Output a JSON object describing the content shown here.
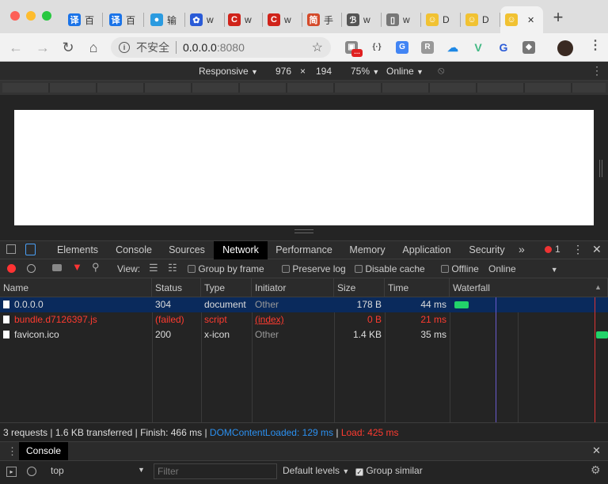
{
  "browser": {
    "tabs": [
      {
        "title": "百",
        "icon": "translate-icon",
        "color": "#1a73e8",
        "glyph": "译"
      },
      {
        "title": "百",
        "icon": "translate-icon",
        "color": "#1a73e8",
        "glyph": "译"
      },
      {
        "title": "输",
        "icon": "input-icon",
        "color": "#2b9be0",
        "glyph": "●"
      },
      {
        "title": "w",
        "icon": "baidu-paw-icon",
        "color": "#2a5bd7",
        "glyph": "✿"
      },
      {
        "title": "w",
        "icon": "c-logo-icon",
        "color": "#d0231a",
        "glyph": "C"
      },
      {
        "title": "w",
        "icon": "c-logo-icon",
        "color": "#d0231a",
        "glyph": "C"
      },
      {
        "title": "手",
        "icon": "jian-icon",
        "color": "#d44a2a",
        "glyph": "简"
      },
      {
        "title": "w",
        "icon": "script-icon",
        "color": "#555555",
        "glyph": "ℬ"
      },
      {
        "title": "w",
        "icon": "file-icon",
        "color": "#777777",
        "glyph": "▯"
      },
      {
        "title": "D",
        "icon": "smiley-icon",
        "color": "#f1c232",
        "glyph": "☺"
      },
      {
        "title": "D",
        "icon": "smiley-icon",
        "color": "#f1c232",
        "glyph": "☺"
      },
      {
        "title": "",
        "icon": "smiley-icon",
        "color": "#f1c232",
        "glyph": "☺"
      }
    ],
    "new_tab": "+",
    "address": {
      "security": "不安全",
      "host": "0.0.0.0",
      "port": ":8080"
    }
  },
  "device_toolbar": {
    "device": "Responsive",
    "width": "976",
    "times": "×",
    "height": "194",
    "zoom": "75%",
    "throttle": "Online"
  },
  "devtools": {
    "tabs": [
      "Elements",
      "Console",
      "Sources",
      "Network",
      "Performance",
      "Memory",
      "Application",
      "Security"
    ],
    "more": "»",
    "error_count": "1",
    "network_toolbar": {
      "view_label": "View:",
      "group_by_frame": "Group by frame",
      "preserve_log": "Preserve log",
      "disable_cache": "Disable cache",
      "offline": "Offline",
      "throttle": "Online"
    },
    "columns": [
      "Name",
      "Status",
      "Type",
      "Initiator",
      "Size",
      "Time",
      "Waterfall"
    ],
    "rows": [
      {
        "name": "0.0.0.0",
        "status": "304",
        "type": "document",
        "initiator": "Other",
        "size": "178 B",
        "time": "44 ms",
        "state": "selected"
      },
      {
        "name": "bundle.d7126397.js",
        "status": "(failed)",
        "type": "script",
        "initiator": "(index)",
        "size": "0 B",
        "time": "21 ms",
        "state": "failed"
      },
      {
        "name": "favicon.ico",
        "status": "200",
        "type": "x-icon",
        "initiator": "Other",
        "size": "1.4 KB",
        "time": "35 ms",
        "state": "normal"
      }
    ],
    "summary": {
      "requests": "3 requests",
      "transferred": "1.6 KB transferred",
      "finish": "Finish: 466 ms",
      "dom_loaded": "DOMContentLoaded: 129 ms",
      "load": "Load: 425 ms",
      "sep": "|"
    },
    "drawer": {
      "tab": "Console",
      "context": "top",
      "filter_placeholder": "Filter",
      "levels": "Default levels",
      "group_similar": "Group similar"
    },
    "colors": {
      "selected_row": "#0a2a5c",
      "error": "#ff3b30",
      "dom_loaded": "#2b90f0",
      "load": "#ff3b30",
      "waterfall_bar": "#22d36a"
    }
  }
}
